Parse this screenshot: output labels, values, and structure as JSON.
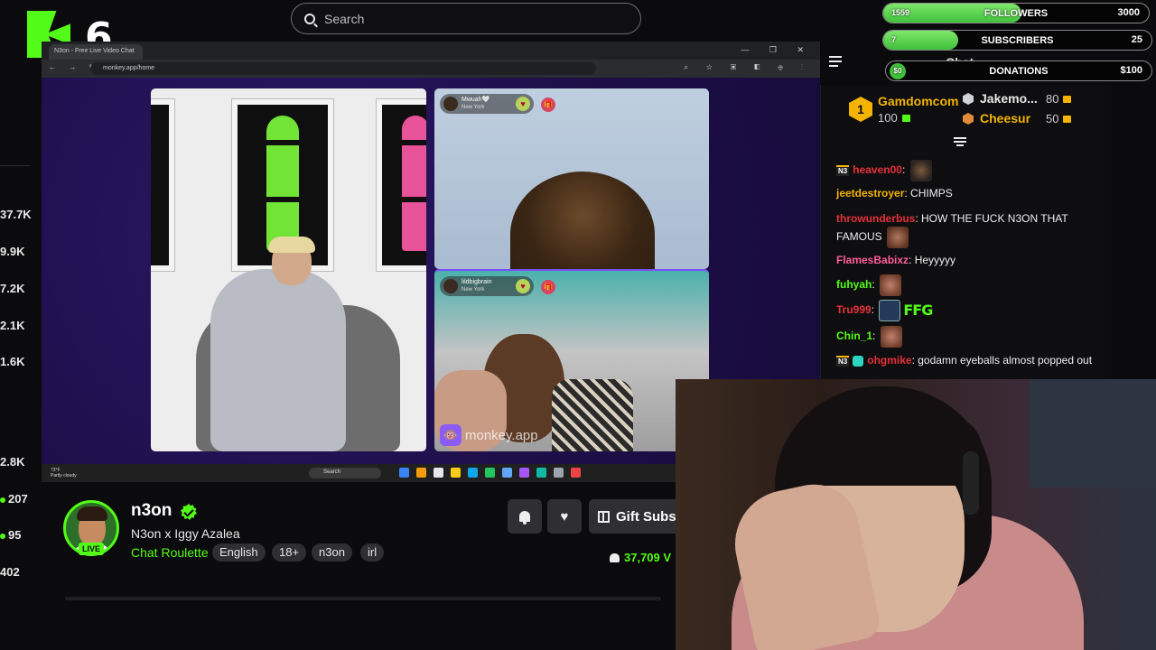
{
  "logo": {
    "count": "6"
  },
  "search": {
    "placeholder": "Search"
  },
  "left_rail": {
    "stats": [
      "37.7K",
      "9.9K",
      "7.2K",
      "2.1K",
      "1.6K",
      "2.8K",
      "207",
      "95",
      "402"
    ]
  },
  "video": {
    "browser_tab": "N3on - Free Live Video Chat",
    "url": "monkey.app/home",
    "weather_temp": "73°F",
    "weather_desc": "Partly cloudy",
    "taskbar_search": "Search",
    "cam2": {
      "user": "Mwuah🤍",
      "location": "New York"
    },
    "cam3": {
      "user": "lildbigbrain",
      "location": "New York"
    },
    "watermark": "monkey.app"
  },
  "stream": {
    "channel": "n3on",
    "title": "N3on x Iggy Azalea",
    "category": "Chat Roulette",
    "tags": [
      "English",
      "18+",
      "n3on",
      "irl"
    ],
    "live": "LIVE",
    "gift_label": "Gift Subs",
    "viewers": "37,709"
  },
  "goals": [
    {
      "label": "FOLLOWERS",
      "current": "1559",
      "max": "3000",
      "progress": 0.52
    },
    {
      "label": "SUBSCRIBERS",
      "current": "7",
      "max": "25",
      "progress": 0.28
    },
    {
      "label": "DONATIONS",
      "current": "$0",
      "max": "$100",
      "progress": 0.0
    }
  ],
  "chat": {
    "title": "Chat",
    "leaderboard": [
      {
        "rank": "1",
        "name": "Gamdomcom",
        "value": "100"
      },
      {
        "rank": "2",
        "name": "Jakemo...",
        "value": "80"
      },
      {
        "rank": "3",
        "name": "Cheesur",
        "value": "50"
      }
    ],
    "messages": [
      {
        "user": "heaven00",
        "text": "",
        "color": "#e8303b",
        "badge": "N3"
      },
      {
        "user": "jeetdestroyer",
        "text": "CHIMPS",
        "color": "#f4b400"
      },
      {
        "user": "throwunderbus",
        "text": "HOW THE FUCK N3ON THAT FAMOUS",
        "color": "#e8303b"
      },
      {
        "user": "FlamesBabixz",
        "text": "Heyyyyy",
        "color": "#ff5c9a"
      },
      {
        "user": "fuhyah",
        "text": "",
        "color": "#53fc18"
      },
      {
        "user": "Tru999",
        "text": "",
        "color": "#e8303b",
        "emote_text": "FFG"
      },
      {
        "user": "Chin_1",
        "text": "",
        "color": "#53fc18"
      },
      {
        "user": "ohgmike",
        "text": "godamn eyeballs almost popped out",
        "color": "#e8303b",
        "badge": "N3"
      }
    ]
  },
  "colors": {
    "accent": "#53fc18",
    "gold": "#f4b400",
    "background": "#0b0b0d"
  }
}
